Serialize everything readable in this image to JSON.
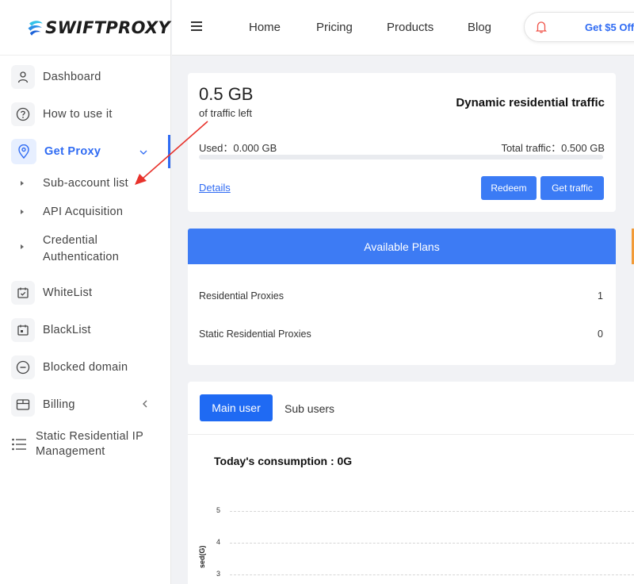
{
  "brand": {
    "logo_text": "SWIFTPROXY"
  },
  "sidebar": {
    "items": [
      {
        "label": "Dashboard",
        "icon": "user-icon"
      },
      {
        "label": "How to use it",
        "icon": "question-icon"
      },
      {
        "label": "Get Proxy",
        "icon": "location-pin-icon",
        "active": true,
        "expanded": true
      },
      {
        "label": "WhiteList",
        "icon": "calendar-check-icon"
      },
      {
        "label": "BlackList",
        "icon": "calendar-icon"
      },
      {
        "label": "Blocked domain",
        "icon": "minus-circle-icon"
      },
      {
        "label": "Billing",
        "icon": "box-icon"
      },
      {
        "label": "Static Residential IP Management",
        "icon": "list-icon"
      }
    ],
    "sub_items": [
      {
        "label": "Sub-account list"
      },
      {
        "label": "API Acquisition"
      },
      {
        "label": "Credential Authentication"
      }
    ]
  },
  "header": {
    "nav": [
      "Home",
      "Pricing",
      "Products",
      "Blog"
    ],
    "promo": "Get $5 Off"
  },
  "traffic": {
    "value": "0.5 GB",
    "subtitle": "of traffic left",
    "title": "Dynamic residential traffic",
    "used": "Used：0.000 GB",
    "total": "Total traffic：0.500 GB",
    "used_fraction": 0,
    "details": "Details",
    "redeem": "Redeem",
    "get_traffic": "Get traffic"
  },
  "plans": {
    "heading": "Available Plans",
    "rows": [
      {
        "name": "Residential Proxies",
        "count": "1"
      },
      {
        "name": "Static Residential Proxies",
        "count": "0"
      }
    ]
  },
  "tabs": {
    "main": "Main user",
    "sub": "Sub users"
  },
  "chart_data": {
    "type": "line",
    "title": "Today's consumption : 0G",
    "ylabel": "sed(G)",
    "yticks": [
      "5",
      "4",
      "3"
    ],
    "ylim": [
      0,
      5
    ],
    "grid": true
  },
  "colors": {
    "accent": "#2f6bf3",
    "annotation_arrow": "#e8322b"
  }
}
